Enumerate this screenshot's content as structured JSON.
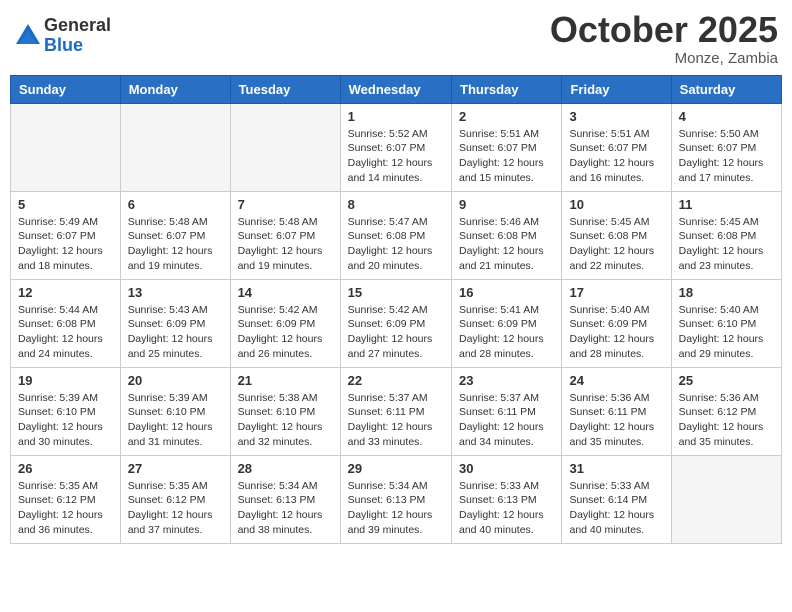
{
  "logo": {
    "general": "General",
    "blue": "Blue"
  },
  "title": "October 2025",
  "location": "Monze, Zambia",
  "days_of_week": [
    "Sunday",
    "Monday",
    "Tuesday",
    "Wednesday",
    "Thursday",
    "Friday",
    "Saturday"
  ],
  "weeks": [
    [
      {
        "day": "",
        "content": ""
      },
      {
        "day": "",
        "content": ""
      },
      {
        "day": "",
        "content": ""
      },
      {
        "day": "1",
        "content": "Sunrise: 5:52 AM\nSunset: 6:07 PM\nDaylight: 12 hours and 14 minutes."
      },
      {
        "day": "2",
        "content": "Sunrise: 5:51 AM\nSunset: 6:07 PM\nDaylight: 12 hours and 15 minutes."
      },
      {
        "day": "3",
        "content": "Sunrise: 5:51 AM\nSunset: 6:07 PM\nDaylight: 12 hours and 16 minutes."
      },
      {
        "day": "4",
        "content": "Sunrise: 5:50 AM\nSunset: 6:07 PM\nDaylight: 12 hours and 17 minutes."
      }
    ],
    [
      {
        "day": "5",
        "content": "Sunrise: 5:49 AM\nSunset: 6:07 PM\nDaylight: 12 hours and 18 minutes."
      },
      {
        "day": "6",
        "content": "Sunrise: 5:48 AM\nSunset: 6:07 PM\nDaylight: 12 hours and 19 minutes."
      },
      {
        "day": "7",
        "content": "Sunrise: 5:48 AM\nSunset: 6:07 PM\nDaylight: 12 hours and 19 minutes."
      },
      {
        "day": "8",
        "content": "Sunrise: 5:47 AM\nSunset: 6:08 PM\nDaylight: 12 hours and 20 minutes."
      },
      {
        "day": "9",
        "content": "Sunrise: 5:46 AM\nSunset: 6:08 PM\nDaylight: 12 hours and 21 minutes."
      },
      {
        "day": "10",
        "content": "Sunrise: 5:45 AM\nSunset: 6:08 PM\nDaylight: 12 hours and 22 minutes."
      },
      {
        "day": "11",
        "content": "Sunrise: 5:45 AM\nSunset: 6:08 PM\nDaylight: 12 hours and 23 minutes."
      }
    ],
    [
      {
        "day": "12",
        "content": "Sunrise: 5:44 AM\nSunset: 6:08 PM\nDaylight: 12 hours and 24 minutes."
      },
      {
        "day": "13",
        "content": "Sunrise: 5:43 AM\nSunset: 6:09 PM\nDaylight: 12 hours and 25 minutes."
      },
      {
        "day": "14",
        "content": "Sunrise: 5:42 AM\nSunset: 6:09 PM\nDaylight: 12 hours and 26 minutes."
      },
      {
        "day": "15",
        "content": "Sunrise: 5:42 AM\nSunset: 6:09 PM\nDaylight: 12 hours and 27 minutes."
      },
      {
        "day": "16",
        "content": "Sunrise: 5:41 AM\nSunset: 6:09 PM\nDaylight: 12 hours and 28 minutes."
      },
      {
        "day": "17",
        "content": "Sunrise: 5:40 AM\nSunset: 6:09 PM\nDaylight: 12 hours and 28 minutes."
      },
      {
        "day": "18",
        "content": "Sunrise: 5:40 AM\nSunset: 6:10 PM\nDaylight: 12 hours and 29 minutes."
      }
    ],
    [
      {
        "day": "19",
        "content": "Sunrise: 5:39 AM\nSunset: 6:10 PM\nDaylight: 12 hours and 30 minutes."
      },
      {
        "day": "20",
        "content": "Sunrise: 5:39 AM\nSunset: 6:10 PM\nDaylight: 12 hours and 31 minutes."
      },
      {
        "day": "21",
        "content": "Sunrise: 5:38 AM\nSunset: 6:10 PM\nDaylight: 12 hours and 32 minutes."
      },
      {
        "day": "22",
        "content": "Sunrise: 5:37 AM\nSunset: 6:11 PM\nDaylight: 12 hours and 33 minutes."
      },
      {
        "day": "23",
        "content": "Sunrise: 5:37 AM\nSunset: 6:11 PM\nDaylight: 12 hours and 34 minutes."
      },
      {
        "day": "24",
        "content": "Sunrise: 5:36 AM\nSunset: 6:11 PM\nDaylight: 12 hours and 35 minutes."
      },
      {
        "day": "25",
        "content": "Sunrise: 5:36 AM\nSunset: 6:12 PM\nDaylight: 12 hours and 35 minutes."
      }
    ],
    [
      {
        "day": "26",
        "content": "Sunrise: 5:35 AM\nSunset: 6:12 PM\nDaylight: 12 hours and 36 minutes."
      },
      {
        "day": "27",
        "content": "Sunrise: 5:35 AM\nSunset: 6:12 PM\nDaylight: 12 hours and 37 minutes."
      },
      {
        "day": "28",
        "content": "Sunrise: 5:34 AM\nSunset: 6:13 PM\nDaylight: 12 hours and 38 minutes."
      },
      {
        "day": "29",
        "content": "Sunrise: 5:34 AM\nSunset: 6:13 PM\nDaylight: 12 hours and 39 minutes."
      },
      {
        "day": "30",
        "content": "Sunrise: 5:33 AM\nSunset: 6:13 PM\nDaylight: 12 hours and 40 minutes."
      },
      {
        "day": "31",
        "content": "Sunrise: 5:33 AM\nSunset: 6:14 PM\nDaylight: 12 hours and 40 minutes."
      },
      {
        "day": "",
        "content": ""
      }
    ]
  ]
}
